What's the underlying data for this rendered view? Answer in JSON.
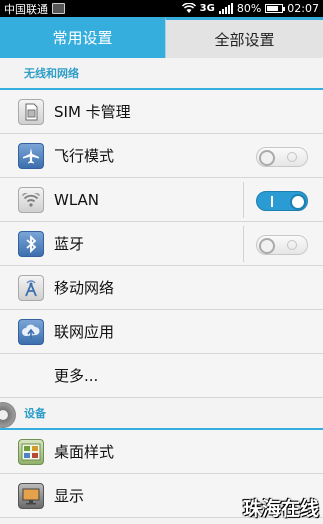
{
  "status_bar": {
    "carrier": "中国联通",
    "network": "3G",
    "battery": "80%",
    "time": "02:07",
    "battery_level": 0.8,
    "icons": [
      "image-icon",
      "wifi-icon",
      "signal-icon",
      "battery-icon"
    ]
  },
  "tabs": [
    {
      "label": "常用设置",
      "selected": false
    },
    {
      "label": "全部设置",
      "selected": true
    }
  ],
  "sections": {
    "wireless": "无线和网络",
    "device": "设备"
  },
  "items": {
    "sim": {
      "label": "SIM 卡管理",
      "icon": "sim-card-icon"
    },
    "airplane": {
      "label": "飞行模式",
      "icon": "airplane-icon",
      "toggle": "off"
    },
    "wlan": {
      "label": "WLAN",
      "icon": "wifi-icon",
      "toggle": "on"
    },
    "bluetooth": {
      "label": "蓝牙",
      "icon": "bluetooth-icon",
      "toggle": "off"
    },
    "mobile": {
      "label": "移动网络",
      "icon": "antenna-icon"
    },
    "apps": {
      "label": "联网应用",
      "icon": "cloud-network-icon"
    },
    "more": {
      "label": "更多..."
    },
    "desktop": {
      "label": "桌面样式",
      "icon": "desktop-style-icon"
    },
    "display": {
      "label": "显示",
      "icon": "display-icon"
    }
  },
  "watermark": "珠海在线",
  "colors": {
    "accent": "#35aedd",
    "toggle_on": "#2b9bd3"
  }
}
